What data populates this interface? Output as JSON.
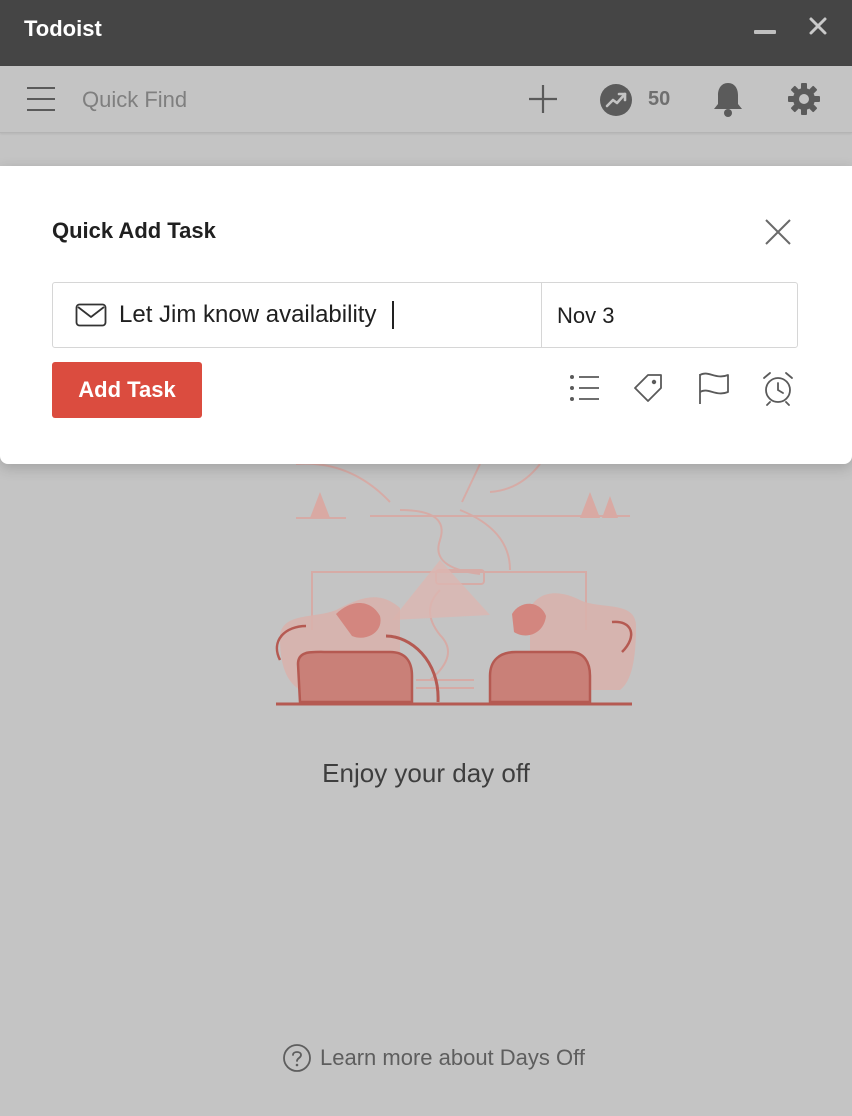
{
  "window": {
    "title": "Todoist"
  },
  "toolbar": {
    "search_placeholder": "Quick Find",
    "karma_count": "50"
  },
  "background": {
    "empty_state_text": "Enjoy your day off",
    "help_link": "Learn more about Days Off"
  },
  "modal": {
    "title": "Quick Add Task",
    "task_value": "Let Jim know availability",
    "date_value": "Nov 3",
    "add_button": "Add Task"
  },
  "colors": {
    "accent": "#db4c3f",
    "titlebar": "#454545",
    "overlay": "#c4c4c4"
  }
}
